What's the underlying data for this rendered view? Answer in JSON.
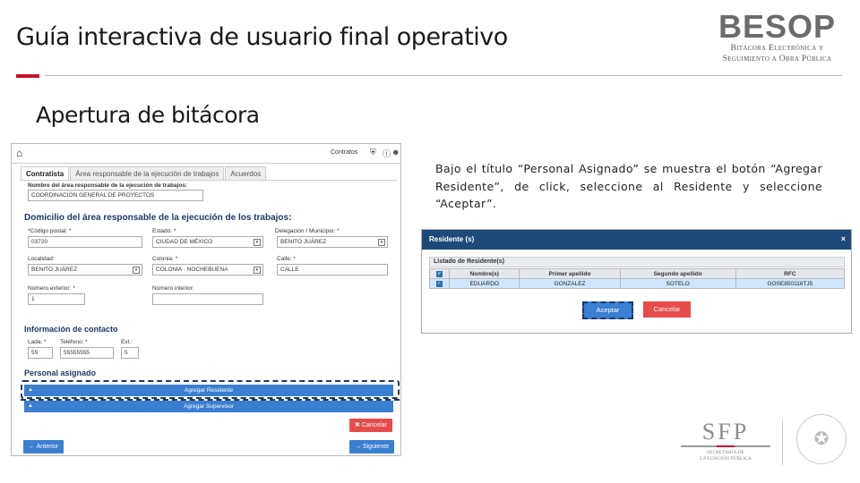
{
  "header": {
    "title": "Guía interactiva de usuario final operativo",
    "logo_main": "BESOP",
    "logo_sub_1": "Bitácora Electrónica y",
    "logo_sub_2": "Seguimiento a Obra Pública"
  },
  "section_title": "Apertura de bitácora",
  "app": {
    "topbar": {
      "menu": "Contratos",
      "icons": [
        "home-icon",
        "shield-icon",
        "info-icon",
        "user-icon"
      ]
    },
    "tabs": [
      "Contratista",
      "Área responsable de la ejecución de trabajos",
      "Acuerdos"
    ],
    "area_name_label": "Nombre del área responsable de la ejecución de trabajos:",
    "area_name_value": "COORDINACIÓN GENERAL DE PROYECTOS",
    "domicilio_title": "Domicilio del área responsable de la ejecución de los trabajos:",
    "cp_label": "*Código postal: *",
    "cp_value": "03720",
    "estado_label": "Estado: *",
    "estado_value": "CIUDAD DE MÉXICO",
    "delegacion_label": "Delegación / Municipio: *",
    "delegacion_value": "BENITO JUÁREZ",
    "localidad_label": "Localidad:",
    "localidad_value": "BENITO JUÁREZ",
    "colonia_label": "Colonia: *",
    "colonia_value": "COLONIA · NOCHEBUENA",
    "calle_label": "Calle: *",
    "calle_value": "CALLE",
    "num_ext_label": "Número exterior: *",
    "num_ext_value": "1",
    "num_int_label": "Número interior:",
    "contacto_title": "Información de contacto",
    "lada_label": "Lada: *",
    "lada_value": "55",
    "telefono_label": "Teléfono: *",
    "telefono_value": "55555555",
    "ext_label": "Ext.:",
    "ext_value": "5",
    "personal_title": "Personal asignado",
    "agregar_residente": "Agregar Residente",
    "agregar_supervisor": "Agregar Supervisor",
    "cancelar": "Cancelar",
    "anterior": "Anterior",
    "siguiente": "Siguiente"
  },
  "instructions": "Bajo el título “Personal Asignado” se muestra el botón “Agregar Residente”, de click, seleccione al  Residente y seleccione “Aceptar”.",
  "modal": {
    "title": "Residente (s)",
    "close": "×",
    "list_title": "Listado de Residente(s)",
    "columns": [
      "Nombre(s)",
      "Primer apellido",
      "Segundo apellido",
      "RFC"
    ],
    "rows": [
      {
        "nombre": "EDUARDO",
        "primer": "GONZALEZ",
        "segundo": "SOTELO",
        "rfc": "GOSE850116TJ5"
      }
    ],
    "accept": "Aceptar",
    "cancel": "Cancelar"
  },
  "footer": {
    "sfp_main": "SFP",
    "sfp_sub_1": "SECRETARÍA DE",
    "sfp_sub_2": "LA FUNCIÓN PÚBLICA"
  },
  "colors": {
    "accent": "#c8102e",
    "primary_blue": "#3a7fd0",
    "navy": "#1e4a78",
    "danger": "#e74c4c"
  }
}
